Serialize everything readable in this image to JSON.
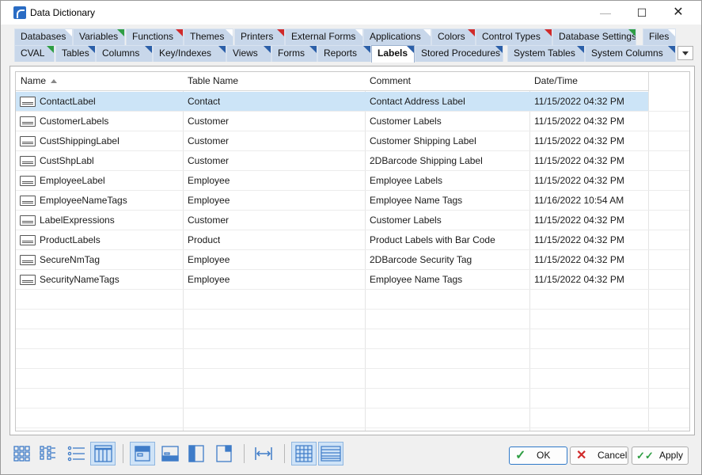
{
  "window": {
    "title": "Data Dictionary",
    "min_glyph": "—",
    "max_glyph": "☐",
    "close_glyph": "✕",
    "icon": "data-dictionary-app-icon"
  },
  "tabs_row1": [
    {
      "label": "Databases",
      "flag": "white"
    },
    {
      "label": "Variables",
      "flag": "green"
    },
    {
      "label": "Functions",
      "flag": "red"
    },
    {
      "label": "Themes",
      "flag": "white"
    },
    {
      "label": "Printers",
      "flag": "red"
    },
    {
      "label": "External Forms",
      "flag": "white"
    },
    {
      "label": "Applications",
      "flag": "white"
    },
    {
      "label": "Colors",
      "flag": "red"
    },
    {
      "label": "Control Types",
      "flag": "red"
    },
    {
      "label": "Database Settings",
      "flag": "green"
    },
    {
      "label": "Files",
      "flag": "white"
    }
  ],
  "tabs_row2": [
    {
      "label": "CVAL",
      "flag": "green"
    },
    {
      "label": "Tables",
      "flag": "blue"
    },
    {
      "label": "Columns",
      "flag": "blue"
    },
    {
      "label": "Key/Indexes",
      "flag": "blue"
    },
    {
      "label": "Views",
      "flag": "blue"
    },
    {
      "label": "Forms",
      "flag": "blue"
    },
    {
      "label": "Reports",
      "flag": "blue"
    },
    {
      "label": "Labels",
      "flag": "blue",
      "active": true
    },
    {
      "label": "Stored Procedures",
      "flag": "blue"
    },
    {
      "label": "System Tables",
      "flag": "blue"
    },
    {
      "label": "System Columns",
      "flag": "blue"
    }
  ],
  "grid": {
    "columns": [
      "Name",
      "Table Name",
      "Comment",
      "Date/Time"
    ],
    "sorted_by": "Name",
    "rows": [
      {
        "name": "ContactLabel",
        "table": "Contact",
        "comment": "Contact Address Label",
        "datetime": "11/15/2022 04:32 PM",
        "selected": true
      },
      {
        "name": "CustomerLabels",
        "table": "Customer",
        "comment": "Customer Labels",
        "datetime": "11/15/2022 04:32 PM"
      },
      {
        "name": "CustShippingLabel",
        "table": "Customer",
        "comment": "Customer Shipping Label",
        "datetime": "11/15/2022 04:32 PM"
      },
      {
        "name": "CustShpLabl",
        "table": "Customer",
        "comment": "2DBarcode Shipping Label",
        "datetime": "11/15/2022 04:32 PM"
      },
      {
        "name": "EmployeeLabel",
        "table": "Employee",
        "comment": "Employee Labels",
        "datetime": "11/15/2022 04:32 PM"
      },
      {
        "name": "EmployeeNameTags",
        "table": "Employee",
        "comment": "Employee Name Tags",
        "datetime": "11/16/2022 10:54 AM"
      },
      {
        "name": "LabelExpressions",
        "table": "Customer",
        "comment": "Customer Labels",
        "datetime": "11/15/2022 04:32 PM"
      },
      {
        "name": "ProductLabels",
        "table": "Product",
        "comment": "Product Labels with Bar Code",
        "datetime": "11/15/2022 04:32 PM"
      },
      {
        "name": "SecureNmTag",
        "table": "Employee",
        "comment": "2DBarcode Security Tag",
        "datetime": "11/15/2022 04:32 PM"
      },
      {
        "name": "SecurityNameTags",
        "table": "Employee",
        "comment": "Employee Name Tags",
        "datetime": "11/15/2022 04:32 PM"
      }
    ]
  },
  "toolbar": {
    "view_buttons": [
      "large-icons-view-icon",
      "small-icons-view-icon",
      "list-view-icon",
      "details-view-icon"
    ],
    "layout_buttons": [
      "layout-top-icon",
      "layout-bottom-icon",
      "layout-left-icon",
      "layout-right-icon"
    ],
    "fit_button": "fit-columns-icon",
    "grid_buttons": [
      "gridlines-icon",
      "row-lines-icon"
    ]
  },
  "buttons": {
    "ok": "OK",
    "cancel": "Cancel",
    "apply": "Apply",
    "ok_glyph": "✓",
    "cancel_glyph": "✕",
    "apply_glyph": "✓✓"
  },
  "colors": {
    "tab_bg": "#c8d7ea",
    "selected_row": "#cce4f7",
    "flag_green": "#2f9e44",
    "flag_red": "#d02a2a",
    "flag_blue": "#2b5fa8"
  }
}
